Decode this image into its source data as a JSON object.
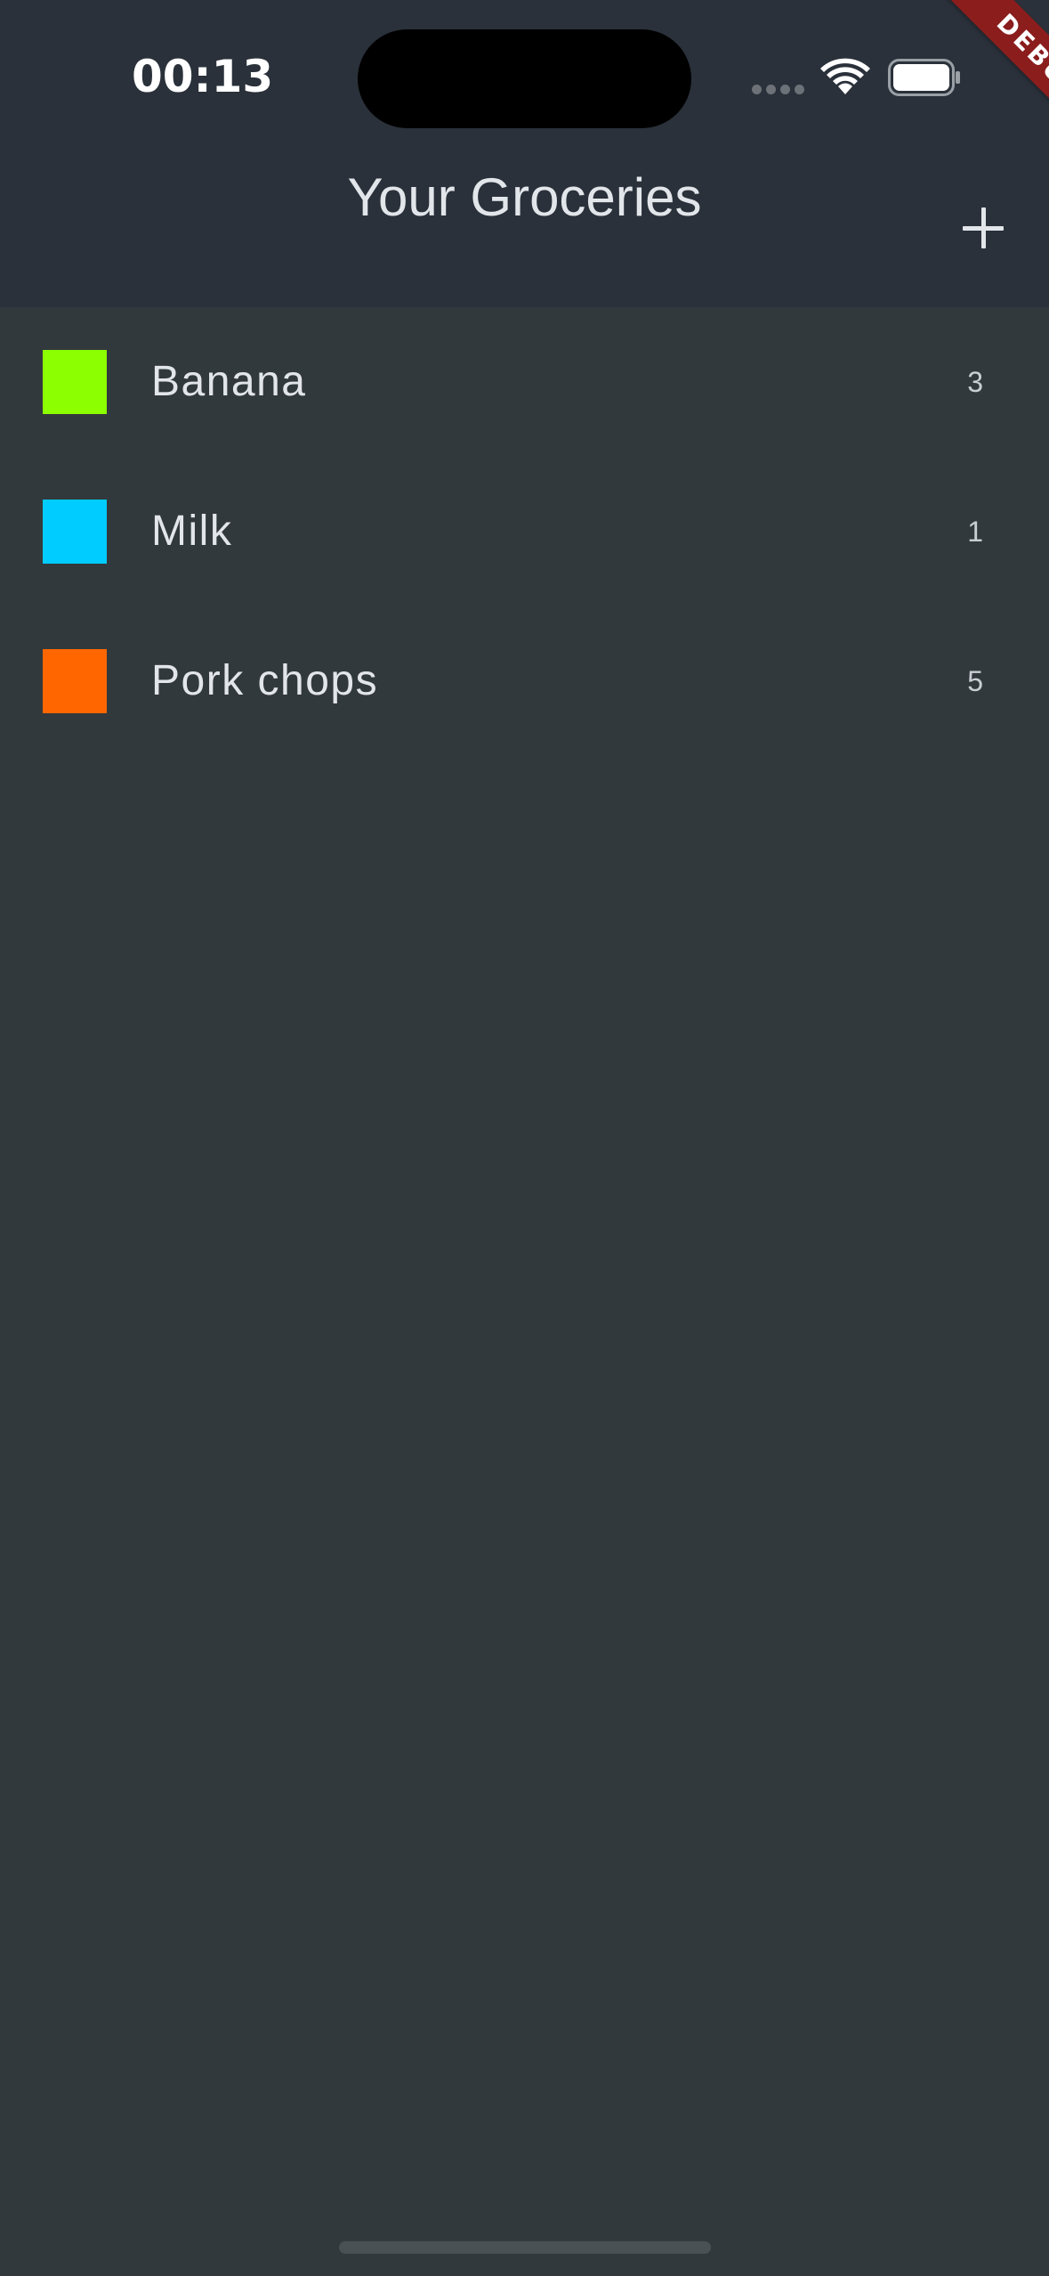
{
  "status_bar": {
    "time": "00:13",
    "wifi_icon": "wifi-icon",
    "battery_icon": "battery-icon",
    "signal_icon": "cellular-signal-icon"
  },
  "app_bar": {
    "title": "Your Groceries",
    "add_icon": "plus-icon"
  },
  "debug_banner": "DEBUG",
  "colors": {
    "header_bg": "#2a313a",
    "body_bg": "#32393c",
    "text": "#e2e6ea",
    "debug_ribbon": "#8b1d1d"
  },
  "groceries": [
    {
      "name": "Banana",
      "quantity": "3",
      "color": "#8cff00"
    },
    {
      "name": "Milk",
      "quantity": "1",
      "color": "#00ccff"
    },
    {
      "name": "Pork chops",
      "quantity": "5",
      "color": "#ff6600"
    }
  ]
}
